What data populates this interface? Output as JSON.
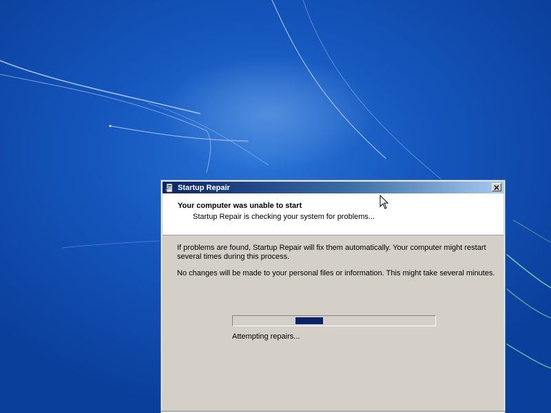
{
  "desktop": {
    "wallpaper": "windows-7-blue-streaks",
    "colors": {
      "base": "#1557bd",
      "glow": "#2a74d6"
    }
  },
  "window": {
    "title": "Startup Repair",
    "icon": "startup-repair-icon",
    "close_icon": "close-icon",
    "colors": {
      "titlebar_start": "#0a246a",
      "titlebar_end": "#a6caf0",
      "face": "#d4d0c8"
    }
  },
  "header": {
    "title": "Your computer was unable to start",
    "subtitle": "Startup Repair is checking your system for problems..."
  },
  "body": {
    "paragraph1": "If problems are found, Startup Repair will fix them automatically. Your computer might restart several times during this process.",
    "paragraph2": "No changes will be made to your personal files or information. This might take several minutes."
  },
  "progress": {
    "label": "Attempting repairs...",
    "indeterminate": true,
    "block_start_fraction": 0.31,
    "block_width_fraction": 0.135,
    "color": "#0a246a"
  }
}
